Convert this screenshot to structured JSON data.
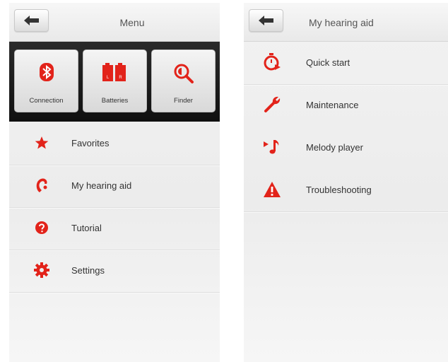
{
  "left_screen": {
    "title": "Menu",
    "back_icon": "back-arrow-icon",
    "tiles": [
      {
        "label": "Connection",
        "icon": "bluetooth-icon"
      },
      {
        "label": "Batteries",
        "icon": "batteries-icon"
      },
      {
        "label": "Finder",
        "icon": "finder-icon"
      }
    ],
    "items": [
      {
        "label": "Favorites",
        "icon": "star-icon"
      },
      {
        "label": "My hearing aid",
        "icon": "hearing-aid-icon"
      },
      {
        "label": "Tutorial",
        "icon": "help-icon"
      },
      {
        "label": "Settings",
        "icon": "gear-icon"
      }
    ],
    "battery_letters": [
      "L",
      "R"
    ]
  },
  "right_screen": {
    "title": "My hearing aid",
    "back_icon": "back-arrow-icon",
    "items": [
      {
        "label": "Quick start",
        "icon": "stopwatch-icon"
      },
      {
        "label": "Maintenance",
        "icon": "wrench-icon"
      },
      {
        "label": "Melody player",
        "icon": "music-note-icon"
      },
      {
        "label": "Troubleshooting",
        "icon": "warning-icon"
      }
    ]
  },
  "colors": {
    "accent": "#e2231a",
    "tile_strip": "#1a1a1a",
    "background": "#eeeeee"
  }
}
